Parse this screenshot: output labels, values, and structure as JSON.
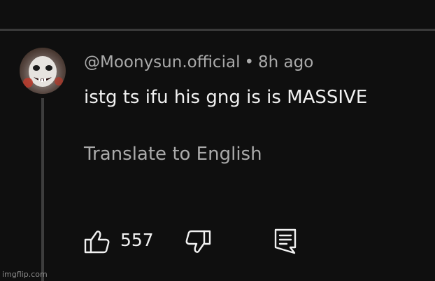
{
  "comment": {
    "handle": "@Moonysun.official",
    "separator": "•",
    "time": "8h ago",
    "text": "istg ts ifu his gng is is MASSIVE",
    "translate_label": "Translate to English",
    "like_count": "557"
  },
  "icons": {
    "like": "thumbs-up-icon",
    "dislike": "thumbs-down-icon",
    "reply": "reply-comment-icon"
  },
  "watermark": "imgflip.com"
}
